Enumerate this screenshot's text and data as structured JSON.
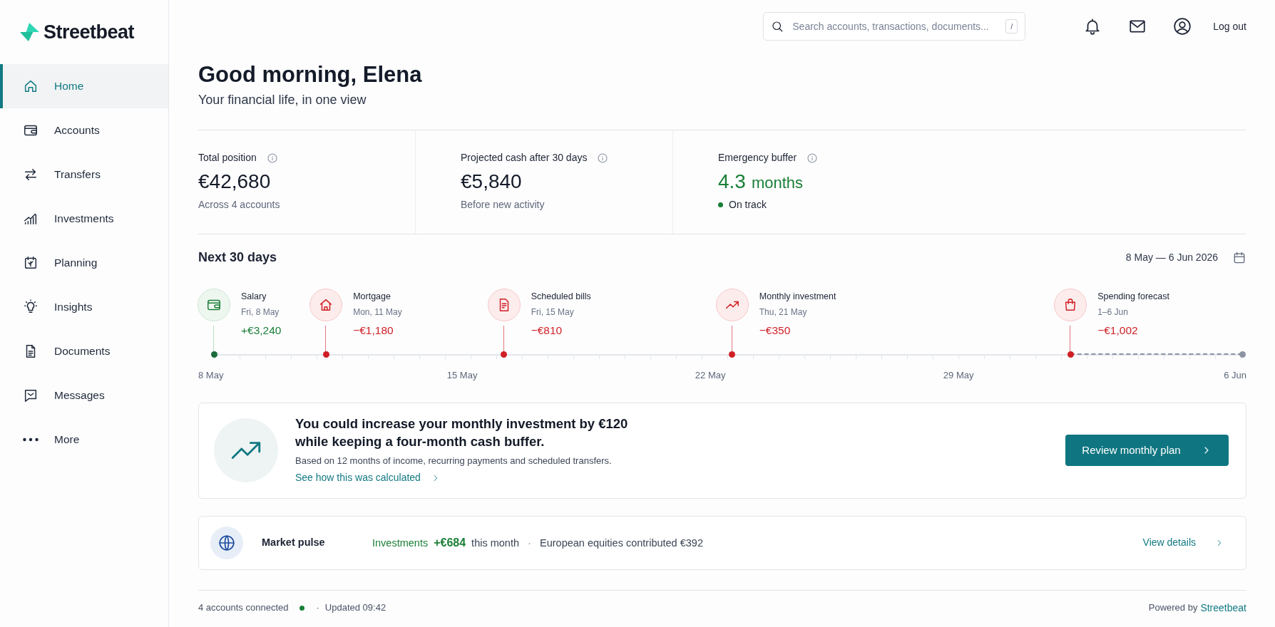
{
  "brand": {
    "name": "Streetbeat"
  },
  "search": {
    "placeholder": "Search accounts, transactions, documents...",
    "shortcut": "/"
  },
  "header": {
    "logout": "Log out"
  },
  "sidebar": {
    "items": [
      {
        "label": "Home",
        "selected": true
      },
      {
        "label": "Accounts",
        "selected": false
      },
      {
        "label": "Transfers",
        "selected": false
      },
      {
        "label": "Investments",
        "selected": false
      },
      {
        "label": "Planning",
        "selected": false
      },
      {
        "label": "Insights",
        "selected": false
      },
      {
        "label": "Documents",
        "selected": false
      },
      {
        "label": "Messages",
        "selected": false
      },
      {
        "label": "More",
        "selected": false
      }
    ]
  },
  "greeting": {
    "title": "Good morning, Elena",
    "subtitle": "Your financial life, in one view"
  },
  "stats": [
    {
      "kind": "plain",
      "label": "Total position",
      "value": "€42,680",
      "note": "Across 4 accounts"
    },
    {
      "kind": "plain",
      "label": "Projected cash after 30 days",
      "value": "€5,840",
      "note": "Before new activity"
    },
    {
      "kind": "status",
      "label": "Emergency buffer",
      "value": "4.3",
      "unit": "months",
      "note": "On track"
    }
  ],
  "timeline": {
    "title": "Next 30 days",
    "range": "8 May — 6 Jun 2026",
    "events": [
      {
        "kind": "income",
        "label": "Salary",
        "date": "Fri, 8 May",
        "amount": "+€3,240"
      },
      {
        "kind": "expense",
        "label": "Mortgage",
        "date": "Mon, 11 May",
        "amount": "−€1,180"
      },
      {
        "kind": "expense",
        "label": "Scheduled bills",
        "date": "Fri, 15 May",
        "amount": "−€810"
      },
      {
        "kind": "expense",
        "label": "Monthly investment",
        "date": "Thu, 21 May",
        "amount": "−€350"
      },
      {
        "kind": "forecast",
        "label": "Spending forecast",
        "date": "1–6 Jun",
        "amount": "−€1,002"
      }
    ],
    "axis_labels": [
      "8 May",
      "15 May",
      "22 May",
      "29 May",
      "6 Jun"
    ]
  },
  "insight": {
    "title_lines": [
      "You could increase your monthly investment by €120",
      "while keeping a four-month cash buffer."
    ],
    "detail": "Based on 12 months of income, recurring payments and scheduled transfers.",
    "link": "See how this was calculated",
    "button": "Review monthly plan"
  },
  "market_pulse": {
    "title": "Market pulse",
    "category": "Investments",
    "amount": "+€684",
    "period": "this month",
    "separator": "·",
    "detail": "European equities contributed €392",
    "link": "View details"
  },
  "footer": {
    "connected": "4 accounts connected",
    "online": true,
    "separator": "·",
    "updated": "Updated 09:42",
    "powered_by": "Powered by",
    "brand": "Streetbeat"
  }
}
